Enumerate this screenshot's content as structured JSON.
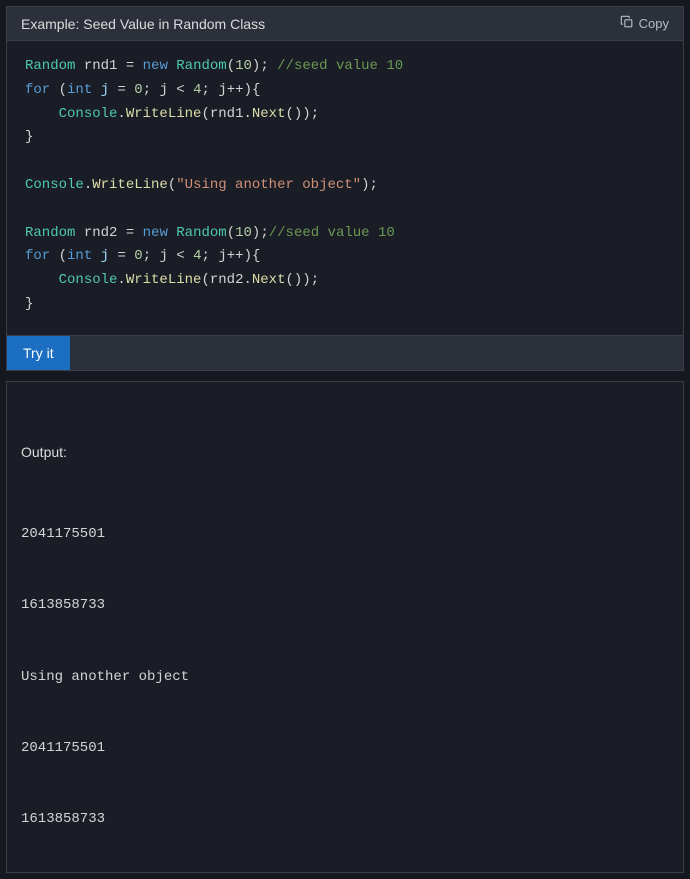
{
  "header": {
    "title": "Example: Seed Value in Random Class",
    "copy_label": "Copy"
  },
  "code": {
    "line1": {
      "type": "Random",
      "var": "rnd1",
      "eq": " = ",
      "kw_new": "new",
      "ctor": "Random",
      "open": "(",
      "seed": "10",
      "close": "); ",
      "comment": "//seed value 10"
    },
    "line2": {
      "kw_for": "for",
      "open": " (",
      "kw_int": "int",
      "var": " j",
      "eq": " = ",
      "zero": "0",
      "semi1": "; ",
      "j2": "j",
      "lt": " < ",
      "four": "4",
      "semi2": "; ",
      "j3": "j",
      "inc": "++",
      "close": "){"
    },
    "line3": {
      "indent": "    ",
      "cls": "Console",
      "dot": ".",
      "fn": "WriteLine",
      "open": "(",
      "obj": "rnd1",
      "dot2": ".",
      "fn2": "Next",
      "call": "());"
    },
    "line4": {
      "brace": "}"
    },
    "blank1": "",
    "line5": {
      "cls": "Console",
      "dot": ".",
      "fn": "WriteLine",
      "open": "(",
      "str": "\"Using another object\"",
      "close": ");"
    },
    "blank2": "",
    "line6": {
      "type": "Random",
      "var": "rnd2",
      "eq": " = ",
      "kw_new": "new",
      "ctor": "Random",
      "open": "(",
      "seed": "10",
      "close": ");",
      "comment": "//seed value 10"
    },
    "line7": {
      "kw_for": "for",
      "open": " (",
      "kw_int": "int",
      "var": " j",
      "eq": " = ",
      "zero": "0",
      "semi1": "; ",
      "j2": "j",
      "lt": " < ",
      "four": "4",
      "semi2": "; ",
      "j3": "j",
      "inc": "++",
      "close": "){"
    },
    "line8": {
      "indent": "    ",
      "cls": "Console",
      "dot": ".",
      "fn": "WriteLine",
      "open": "(",
      "obj": "rnd2",
      "dot2": ".",
      "fn2": "Next",
      "call": "());"
    },
    "line9": {
      "brace": "}"
    }
  },
  "tryit": {
    "label": "Try it"
  },
  "output": {
    "label": "Output:",
    "lines": [
      "2041175501",
      "1613858733",
      "Using another object",
      "2041175501",
      "1613858733"
    ]
  }
}
